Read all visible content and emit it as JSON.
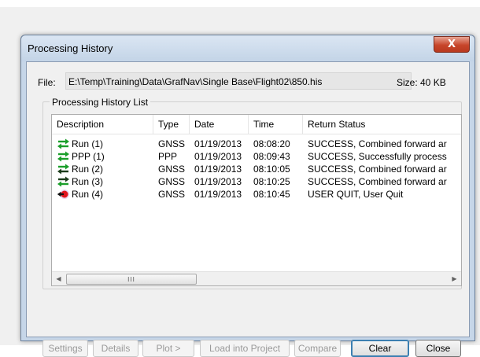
{
  "window": {
    "title": "Processing History",
    "close_label": "X"
  },
  "file": {
    "label": "File:",
    "path": "E:\\Temp\\Training\\Data\\GrafNav\\Single Base\\Flight02\\850.his",
    "size": "Size: 40 KB"
  },
  "group": {
    "legend": "Processing History List"
  },
  "columns": [
    "Description",
    "Type",
    "Date",
    "Time",
    "Return Status"
  ],
  "rows": [
    {
      "description": "Run (1)",
      "type": "GNSS",
      "date": "01/19/2013",
      "time": "08:08:20",
      "status": "SUCCESS, Combined forward ar",
      "icon": "green-arrows-icon"
    },
    {
      "description": "PPP (1)",
      "type": "PPP",
      "date": "01/19/2013",
      "time": "08:09:43",
      "status": "SUCCESS, Successfully process",
      "icon": "green-arrows-icon"
    },
    {
      "description": "Run (2)",
      "type": "GNSS",
      "date": "01/19/2013",
      "time": "08:10:05",
      "status": "SUCCESS, Combined forward ar",
      "icon": "green-dark-arrows-icon"
    },
    {
      "description": "Run (3)",
      "type": "GNSS",
      "date": "01/19/2013",
      "time": "08:10:25",
      "status": "SUCCESS, Combined forward ar",
      "icon": "dark-green-arrows-icon"
    },
    {
      "description": "Run (4)",
      "type": "GNSS",
      "date": "01/19/2013",
      "time": "08:10:45",
      "status": "USER QUIT, User Quit",
      "icon": "red-stop-arrow-icon"
    }
  ],
  "scrollbar": {
    "thumb_grip": "III"
  },
  "buttons": {
    "settings": "Settings",
    "details": "Details",
    "plot": "Plot  >",
    "load": "Load into Project",
    "compare": "Compare",
    "clear": "Clear",
    "close": "Close"
  },
  "colors": {
    "green_arrow": "#1a9e2a",
    "dark_arrow": "#1c3d1c",
    "red_stop": "#e0141e"
  }
}
